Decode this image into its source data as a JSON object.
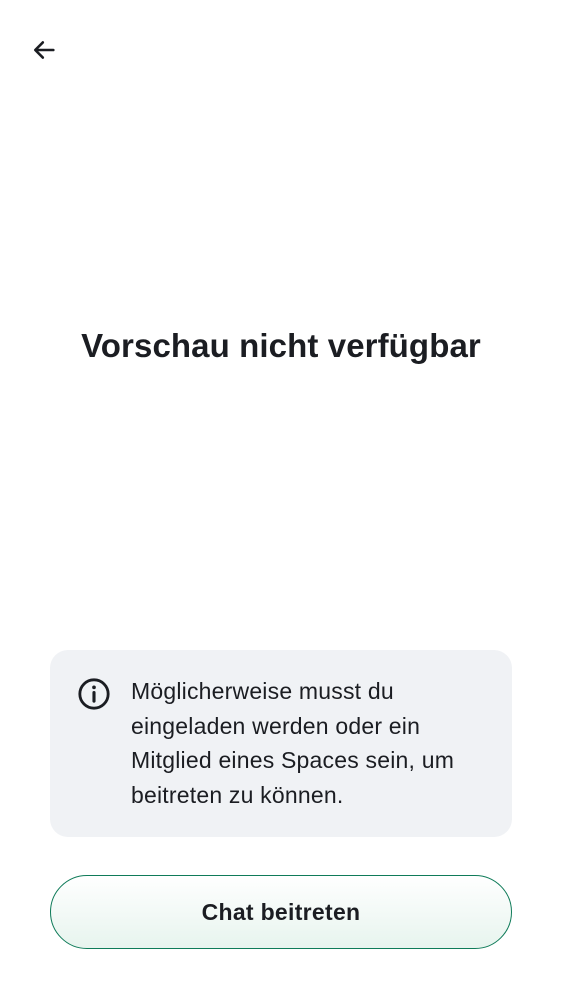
{
  "header": {
    "back_icon": "arrow-left-icon"
  },
  "main": {
    "title": "Vorschau nicht verfügbar"
  },
  "info_card": {
    "icon": "info-icon",
    "text": "Möglicherweise musst du eingeladen werden oder ein Mitglied eines Spaces sein, um beitreten zu können."
  },
  "actions": {
    "join_label": "Chat beitreten"
  },
  "colors": {
    "accent": "#0f7b59",
    "card_background": "#f0f2f5",
    "text": "#1b1d22"
  }
}
